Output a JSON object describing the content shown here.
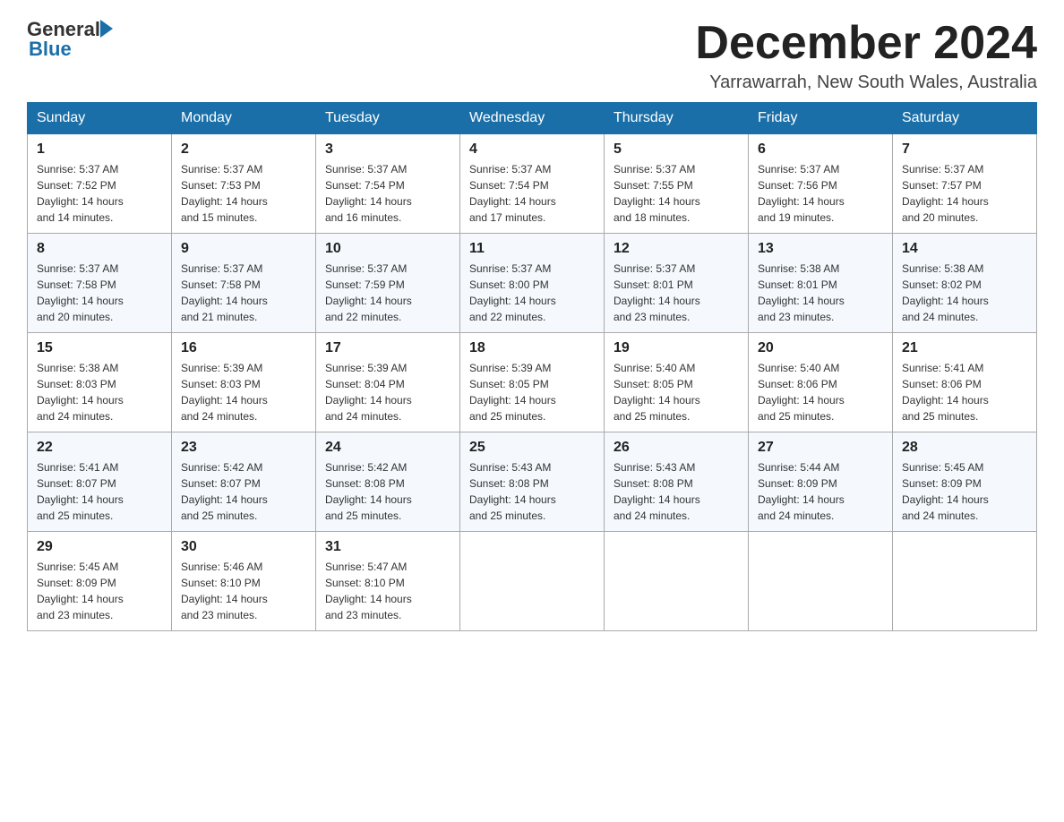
{
  "header": {
    "logo": {
      "general": "General",
      "blue": "Blue",
      "arrow_color": "#1a6fa8"
    },
    "title": "December 2024",
    "location": "Yarrawarrah, New South Wales, Australia"
  },
  "days_of_week": [
    "Sunday",
    "Monday",
    "Tuesday",
    "Wednesday",
    "Thursday",
    "Friday",
    "Saturday"
  ],
  "weeks": [
    [
      {
        "day": "1",
        "sunrise": "5:37 AM",
        "sunset": "7:52 PM",
        "daylight": "14 hours and 14 minutes."
      },
      {
        "day": "2",
        "sunrise": "5:37 AM",
        "sunset": "7:53 PM",
        "daylight": "14 hours and 15 minutes."
      },
      {
        "day": "3",
        "sunrise": "5:37 AM",
        "sunset": "7:54 PM",
        "daylight": "14 hours and 16 minutes."
      },
      {
        "day": "4",
        "sunrise": "5:37 AM",
        "sunset": "7:54 PM",
        "daylight": "14 hours and 17 minutes."
      },
      {
        "day": "5",
        "sunrise": "5:37 AM",
        "sunset": "7:55 PM",
        "daylight": "14 hours and 18 minutes."
      },
      {
        "day": "6",
        "sunrise": "5:37 AM",
        "sunset": "7:56 PM",
        "daylight": "14 hours and 19 minutes."
      },
      {
        "day": "7",
        "sunrise": "5:37 AM",
        "sunset": "7:57 PM",
        "daylight": "14 hours and 20 minutes."
      }
    ],
    [
      {
        "day": "8",
        "sunrise": "5:37 AM",
        "sunset": "7:58 PM",
        "daylight": "14 hours and 20 minutes."
      },
      {
        "day": "9",
        "sunrise": "5:37 AM",
        "sunset": "7:58 PM",
        "daylight": "14 hours and 21 minutes."
      },
      {
        "day": "10",
        "sunrise": "5:37 AM",
        "sunset": "7:59 PM",
        "daylight": "14 hours and 22 minutes."
      },
      {
        "day": "11",
        "sunrise": "5:37 AM",
        "sunset": "8:00 PM",
        "daylight": "14 hours and 22 minutes."
      },
      {
        "day": "12",
        "sunrise": "5:37 AM",
        "sunset": "8:01 PM",
        "daylight": "14 hours and 23 minutes."
      },
      {
        "day": "13",
        "sunrise": "5:38 AM",
        "sunset": "8:01 PM",
        "daylight": "14 hours and 23 minutes."
      },
      {
        "day": "14",
        "sunrise": "5:38 AM",
        "sunset": "8:02 PM",
        "daylight": "14 hours and 24 minutes."
      }
    ],
    [
      {
        "day": "15",
        "sunrise": "5:38 AM",
        "sunset": "8:03 PM",
        "daylight": "14 hours and 24 minutes."
      },
      {
        "day": "16",
        "sunrise": "5:39 AM",
        "sunset": "8:03 PM",
        "daylight": "14 hours and 24 minutes."
      },
      {
        "day": "17",
        "sunrise": "5:39 AM",
        "sunset": "8:04 PM",
        "daylight": "14 hours and 24 minutes."
      },
      {
        "day": "18",
        "sunrise": "5:39 AM",
        "sunset": "8:05 PM",
        "daylight": "14 hours and 25 minutes."
      },
      {
        "day": "19",
        "sunrise": "5:40 AM",
        "sunset": "8:05 PM",
        "daylight": "14 hours and 25 minutes."
      },
      {
        "day": "20",
        "sunrise": "5:40 AM",
        "sunset": "8:06 PM",
        "daylight": "14 hours and 25 minutes."
      },
      {
        "day": "21",
        "sunrise": "5:41 AM",
        "sunset": "8:06 PM",
        "daylight": "14 hours and 25 minutes."
      }
    ],
    [
      {
        "day": "22",
        "sunrise": "5:41 AM",
        "sunset": "8:07 PM",
        "daylight": "14 hours and 25 minutes."
      },
      {
        "day": "23",
        "sunrise": "5:42 AM",
        "sunset": "8:07 PM",
        "daylight": "14 hours and 25 minutes."
      },
      {
        "day": "24",
        "sunrise": "5:42 AM",
        "sunset": "8:08 PM",
        "daylight": "14 hours and 25 minutes."
      },
      {
        "day": "25",
        "sunrise": "5:43 AM",
        "sunset": "8:08 PM",
        "daylight": "14 hours and 25 minutes."
      },
      {
        "day": "26",
        "sunrise": "5:43 AM",
        "sunset": "8:08 PM",
        "daylight": "14 hours and 24 minutes."
      },
      {
        "day": "27",
        "sunrise": "5:44 AM",
        "sunset": "8:09 PM",
        "daylight": "14 hours and 24 minutes."
      },
      {
        "day": "28",
        "sunrise": "5:45 AM",
        "sunset": "8:09 PM",
        "daylight": "14 hours and 24 minutes."
      }
    ],
    [
      {
        "day": "29",
        "sunrise": "5:45 AM",
        "sunset": "8:09 PM",
        "daylight": "14 hours and 23 minutes."
      },
      {
        "day": "30",
        "sunrise": "5:46 AM",
        "sunset": "8:10 PM",
        "daylight": "14 hours and 23 minutes."
      },
      {
        "day": "31",
        "sunrise": "5:47 AM",
        "sunset": "8:10 PM",
        "daylight": "14 hours and 23 minutes."
      },
      null,
      null,
      null,
      null
    ]
  ],
  "labels": {
    "sunrise": "Sunrise:",
    "sunset": "Sunset:",
    "daylight": "Daylight:"
  }
}
